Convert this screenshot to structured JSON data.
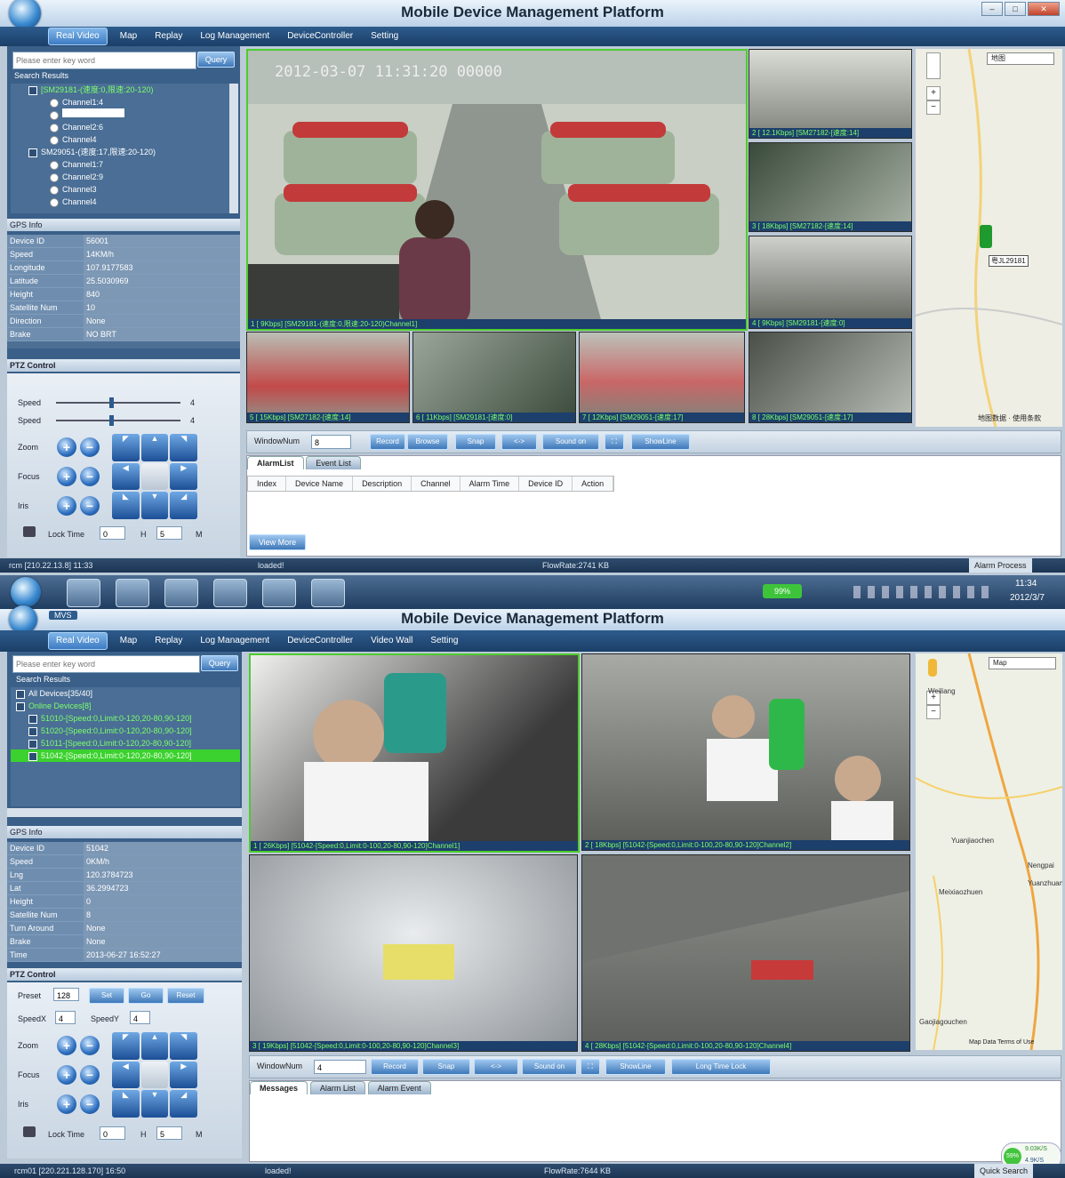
{
  "top": {
    "title": "Mobile Device Management Platform",
    "menu": [
      "Real Video",
      "Map",
      "Replay",
      "Log Management",
      "DeviceController",
      "Setting"
    ],
    "search_placeholder": "Please enter key word",
    "query_label": "Query",
    "search_results_label": "Search Results",
    "tree": [
      {
        "label": "[SM29181-(速度:0,限速:20-120)",
        "kind": "device",
        "sel": true
      },
      {
        "label": "Channel1:4",
        "kind": "channel"
      },
      {
        "label": "",
        "kind": "channel",
        "blank": true
      },
      {
        "label": "Channel2:6",
        "kind": "channel"
      },
      {
        "label": "Channel4",
        "kind": "channel"
      },
      {
        "label": "SM29051-(速度:17,限速:20-120)",
        "kind": "device"
      },
      {
        "label": "Channel1:7",
        "kind": "channel"
      },
      {
        "label": "Channel2:9",
        "kind": "channel"
      },
      {
        "label": "Channel3",
        "kind": "channel"
      },
      {
        "label": "Channel4",
        "kind": "channel"
      }
    ],
    "gps_header": "GPS Info",
    "gps": [
      {
        "k": "Device ID",
        "v": "56001"
      },
      {
        "k": "Speed",
        "v": "14KM/h"
      },
      {
        "k": "Longitude",
        "v": "107.9177583"
      },
      {
        "k": "Latitude",
        "v": "25.5030969"
      },
      {
        "k": "Height",
        "v": "840"
      },
      {
        "k": "Satellite Num",
        "v": "10"
      },
      {
        "k": "Direction",
        "v": "None"
      },
      {
        "k": "Brake",
        "v": "NO BRT"
      }
    ],
    "ptz_header": "PTZ Control",
    "ptz": {
      "speed1": "Speed",
      "speed2": "Speed",
      "val1": "4",
      "val2": "4",
      "zoom": "Zoom",
      "focus": "Focus",
      "iris": "Iris",
      "lock": "Lock Time",
      "lock_h": "0",
      "h": "H",
      "lock_m": "5",
      "m": "M"
    },
    "video_main_caption": "1 [ 9Kbps] [SM29181-(速度:0,限速:20-120)Channel1]",
    "video_main_overlay": "2012-03-07 11:31:20 00000",
    "side_captions": [
      "2 [ 12.1Kbps] [SM27182-[速度:14]",
      "3 [ 18Kbps] [SM27182-[速度:14]",
      "4 [ 9Kbps] [SM29181-[速度:0]"
    ],
    "bottom_captions": [
      "5 [ 15Kbps] [SM27182-[速度:14]",
      "6 [ 11Kbps] [SM29181-[速度:0]",
      "7 [ 12Kbps] [SM29051-[速度:17]",
      "8 [ 28Kbps] [SM29051-[速度:17]"
    ],
    "window_num_label": "WindowNum",
    "window_num": "8",
    "toolbar": [
      "Record",
      "Browse",
      "Snap",
      "<->",
      "Sound on",
      "ShowLine"
    ],
    "tabs": [
      "AlarmList",
      "Event List"
    ],
    "alarm_columns": [
      "Index",
      "Device Name",
      "Description",
      "Channel",
      "Alarm Time",
      "Device ID",
      "Action"
    ],
    "view_more": "View More",
    "status": {
      "left": "rcm [210.22.13.8]  11:33",
      "mid": "loaded!",
      "flow": "FlowRate:2741 KB",
      "right": "Alarm Process"
    },
    "map_dropdown": "地图",
    "map_label": "粤JL29181",
    "map_footer": "地图数据 · 使用条款",
    "clock_time": "11:34",
    "clock_date": "2012/3/7",
    "battery": "99%"
  },
  "bottom": {
    "app_tag": "MVS",
    "title": "Mobile Device Management Platform",
    "menu": [
      "Real Video",
      "Map",
      "Replay",
      "Log Management",
      "DeviceController",
      "Video Wall",
      "Setting"
    ],
    "search_placeholder": "Please enter key word",
    "query_label": "Query",
    "search_results_label": "Search Results",
    "tree": [
      {
        "label": "All Devices[35/40]",
        "kind": "folder"
      },
      {
        "label": "Online Devices[8]",
        "kind": "folder",
        "sel": true
      },
      {
        "label": "51010-[Speed:0,Limit:0-120,20-80,90-120]",
        "kind": "device",
        "sel": true
      },
      {
        "label": "51020-[Speed:0,Limit:0-120,20-80,90-120]",
        "kind": "device",
        "sel": true
      },
      {
        "label": "51011-[Speed:0,Limit:0-120,20-80,90-120]",
        "kind": "device",
        "sel": true
      },
      {
        "label": "51042-[Speed:0,Limit:0-120,20-80,90-120]",
        "kind": "device",
        "hl": true
      }
    ],
    "gps_header": "GPS Info",
    "gps": [
      {
        "k": "Device ID",
        "v": "51042"
      },
      {
        "k": "Speed",
        "v": "0KM/h"
      },
      {
        "k": "Lng",
        "v": "120.3784723"
      },
      {
        "k": "Lat",
        "v": "36.2994723"
      },
      {
        "k": "Height",
        "v": "0"
      },
      {
        "k": "Satellite Num",
        "v": "8"
      },
      {
        "k": "Turn Around",
        "v": "None"
      },
      {
        "k": "Brake",
        "v": "None"
      },
      {
        "k": "Time",
        "v": "2013-06-27 16:52:27"
      }
    ],
    "ptz_header": "PTZ Control",
    "ptz": {
      "preset": "Preset",
      "preset_val": "128",
      "set": "Set",
      "go": "Go",
      "reset": "Reset",
      "speedx": "SpeedX",
      "speedx_val": "4",
      "speedy": "SpeedY",
      "speedy_val": "4",
      "zoom": "Zoom",
      "focus": "Focus",
      "iris": "Iris",
      "lock": "Lock Time",
      "lock_h": "0",
      "h": "H",
      "lock_m": "5",
      "m": "M"
    },
    "captions": [
      "1 [ 26Kbps] [51042-[Speed:0,Limit:0-100,20-80,90-120]Channel1]",
      "2 [ 18Kbps] [51042-[Speed:0,Limit:0-100,20-80,90-120]Channel2]",
      "3 [ 19Kbps] [51042-[Speed:0,Limit:0-100,20-80,90-120]Channel3]",
      "4 [ 28Kbps] [51042-[Speed:0,Limit:0-100,20-80,90-120]Channel4]"
    ],
    "window_num_label": "WindowNum",
    "window_num": "4",
    "toolbar": [
      "Record",
      "Snap",
      "<->",
      "Sound on",
      "ShowLine",
      "Long Time Lock"
    ],
    "tabs": [
      "Messages",
      "Alarm List",
      "Alarm Event"
    ],
    "status": {
      "left": "rcm01 [220.221.128.170]  16:50",
      "mid": "loaded!",
      "flow": "FlowRate:7644 KB",
      "right": "Quick Search"
    },
    "map_dropdown": "Map",
    "map_places": [
      "Weiliang",
      "Yuanjiaochen",
      "Nengpai",
      "Meixiaozhuen",
      "Yuanzhuan",
      "Gaojiagouchen"
    ],
    "map_footer": "Map Data  Terms of Use",
    "net_badge": "59%",
    "net_up": "9.03K/S",
    "net_down": "4.9K/S"
  },
  "colors": {
    "active_border": "#4dcc2d",
    "caption_text": "#7dff6a",
    "menu_bg": "#1b3f68"
  }
}
